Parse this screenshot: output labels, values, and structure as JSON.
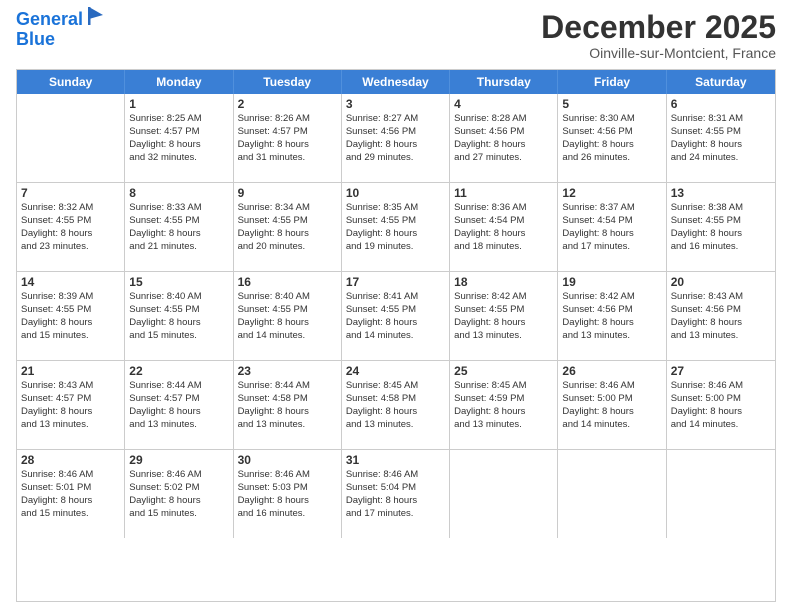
{
  "logo": {
    "line1": "General",
    "line2": "Blue"
  },
  "header": {
    "month": "December 2025",
    "location": "Oinville-sur-Montcient, France"
  },
  "weekdays": [
    "Sunday",
    "Monday",
    "Tuesday",
    "Wednesday",
    "Thursday",
    "Friday",
    "Saturday"
  ],
  "rows": [
    [
      {
        "day": "",
        "info": ""
      },
      {
        "day": "1",
        "info": "Sunrise: 8:25 AM\nSunset: 4:57 PM\nDaylight: 8 hours\nand 32 minutes."
      },
      {
        "day": "2",
        "info": "Sunrise: 8:26 AM\nSunset: 4:57 PM\nDaylight: 8 hours\nand 31 minutes."
      },
      {
        "day": "3",
        "info": "Sunrise: 8:27 AM\nSunset: 4:56 PM\nDaylight: 8 hours\nand 29 minutes."
      },
      {
        "day": "4",
        "info": "Sunrise: 8:28 AM\nSunset: 4:56 PM\nDaylight: 8 hours\nand 27 minutes."
      },
      {
        "day": "5",
        "info": "Sunrise: 8:30 AM\nSunset: 4:56 PM\nDaylight: 8 hours\nand 26 minutes."
      },
      {
        "day": "6",
        "info": "Sunrise: 8:31 AM\nSunset: 4:55 PM\nDaylight: 8 hours\nand 24 minutes."
      }
    ],
    [
      {
        "day": "7",
        "info": "Sunrise: 8:32 AM\nSunset: 4:55 PM\nDaylight: 8 hours\nand 23 minutes."
      },
      {
        "day": "8",
        "info": "Sunrise: 8:33 AM\nSunset: 4:55 PM\nDaylight: 8 hours\nand 21 minutes."
      },
      {
        "day": "9",
        "info": "Sunrise: 8:34 AM\nSunset: 4:55 PM\nDaylight: 8 hours\nand 20 minutes."
      },
      {
        "day": "10",
        "info": "Sunrise: 8:35 AM\nSunset: 4:55 PM\nDaylight: 8 hours\nand 19 minutes."
      },
      {
        "day": "11",
        "info": "Sunrise: 8:36 AM\nSunset: 4:54 PM\nDaylight: 8 hours\nand 18 minutes."
      },
      {
        "day": "12",
        "info": "Sunrise: 8:37 AM\nSunset: 4:54 PM\nDaylight: 8 hours\nand 17 minutes."
      },
      {
        "day": "13",
        "info": "Sunrise: 8:38 AM\nSunset: 4:55 PM\nDaylight: 8 hours\nand 16 minutes."
      }
    ],
    [
      {
        "day": "14",
        "info": "Sunrise: 8:39 AM\nSunset: 4:55 PM\nDaylight: 8 hours\nand 15 minutes."
      },
      {
        "day": "15",
        "info": "Sunrise: 8:40 AM\nSunset: 4:55 PM\nDaylight: 8 hours\nand 15 minutes."
      },
      {
        "day": "16",
        "info": "Sunrise: 8:40 AM\nSunset: 4:55 PM\nDaylight: 8 hours\nand 14 minutes."
      },
      {
        "day": "17",
        "info": "Sunrise: 8:41 AM\nSunset: 4:55 PM\nDaylight: 8 hours\nand 14 minutes."
      },
      {
        "day": "18",
        "info": "Sunrise: 8:42 AM\nSunset: 4:55 PM\nDaylight: 8 hours\nand 13 minutes."
      },
      {
        "day": "19",
        "info": "Sunrise: 8:42 AM\nSunset: 4:56 PM\nDaylight: 8 hours\nand 13 minutes."
      },
      {
        "day": "20",
        "info": "Sunrise: 8:43 AM\nSunset: 4:56 PM\nDaylight: 8 hours\nand 13 minutes."
      }
    ],
    [
      {
        "day": "21",
        "info": "Sunrise: 8:43 AM\nSunset: 4:57 PM\nDaylight: 8 hours\nand 13 minutes."
      },
      {
        "day": "22",
        "info": "Sunrise: 8:44 AM\nSunset: 4:57 PM\nDaylight: 8 hours\nand 13 minutes."
      },
      {
        "day": "23",
        "info": "Sunrise: 8:44 AM\nSunset: 4:58 PM\nDaylight: 8 hours\nand 13 minutes."
      },
      {
        "day": "24",
        "info": "Sunrise: 8:45 AM\nSunset: 4:58 PM\nDaylight: 8 hours\nand 13 minutes."
      },
      {
        "day": "25",
        "info": "Sunrise: 8:45 AM\nSunset: 4:59 PM\nDaylight: 8 hours\nand 13 minutes."
      },
      {
        "day": "26",
        "info": "Sunrise: 8:46 AM\nSunset: 5:00 PM\nDaylight: 8 hours\nand 14 minutes."
      },
      {
        "day": "27",
        "info": "Sunrise: 8:46 AM\nSunset: 5:00 PM\nDaylight: 8 hours\nand 14 minutes."
      }
    ],
    [
      {
        "day": "28",
        "info": "Sunrise: 8:46 AM\nSunset: 5:01 PM\nDaylight: 8 hours\nand 15 minutes."
      },
      {
        "day": "29",
        "info": "Sunrise: 8:46 AM\nSunset: 5:02 PM\nDaylight: 8 hours\nand 15 minutes."
      },
      {
        "day": "30",
        "info": "Sunrise: 8:46 AM\nSunset: 5:03 PM\nDaylight: 8 hours\nand 16 minutes."
      },
      {
        "day": "31",
        "info": "Sunrise: 8:46 AM\nSunset: 5:04 PM\nDaylight: 8 hours\nand 17 minutes."
      },
      {
        "day": "",
        "info": ""
      },
      {
        "day": "",
        "info": ""
      },
      {
        "day": "",
        "info": ""
      }
    ]
  ]
}
